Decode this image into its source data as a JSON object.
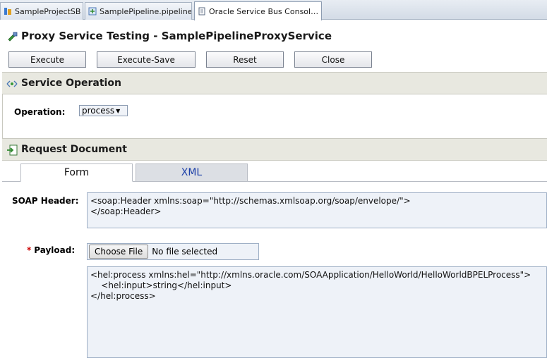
{
  "editor_tabs": [
    {
      "label": "SampleProjectSB",
      "icon": "project-icon"
    },
    {
      "label": "SamplePipeline.pipeline",
      "icon": "pipeline-icon",
      "close": "×"
    },
    {
      "label": "Oracle Service Bus Consol…",
      "icon": "page-icon",
      "close": "×"
    }
  ],
  "page": {
    "title": "Proxy Service Testing - SamplePipelineProxyService"
  },
  "toolbar": {
    "execute": "Execute",
    "execute_save": "Execute-Save",
    "reset": "Reset",
    "close": "Close"
  },
  "service_operation": {
    "heading": "Service Operation",
    "operation_label": "Operation:",
    "operation_value": "process"
  },
  "request_document": {
    "heading": "Request Document",
    "tabs": [
      {
        "label": "Form",
        "active": true
      },
      {
        "label": "XML",
        "active": false
      }
    ],
    "soap_header_label": "SOAP Header:",
    "soap_header_value": "<soap:Header xmlns:soap=\"http://schemas.xmlsoap.org/soap/envelope/\">\n</soap:Header>",
    "payload_required_marker": "*",
    "payload_label": "Payload:",
    "choose_file_label": "Choose File",
    "file_status": "No file selected",
    "payload_value": "<hel:process xmlns:hel=\"http://xmlns.oracle.com/SOAApplication/HelloWorld/HelloWorldBPELProcess\">\n    <hel:input>string</hel:input>\n</hel:process>"
  },
  "colors": {
    "section_bg": "#e8e8e0",
    "field_bg": "#eef2f8",
    "link_blue": "#1b3fa8",
    "required_red": "#cc0000"
  }
}
